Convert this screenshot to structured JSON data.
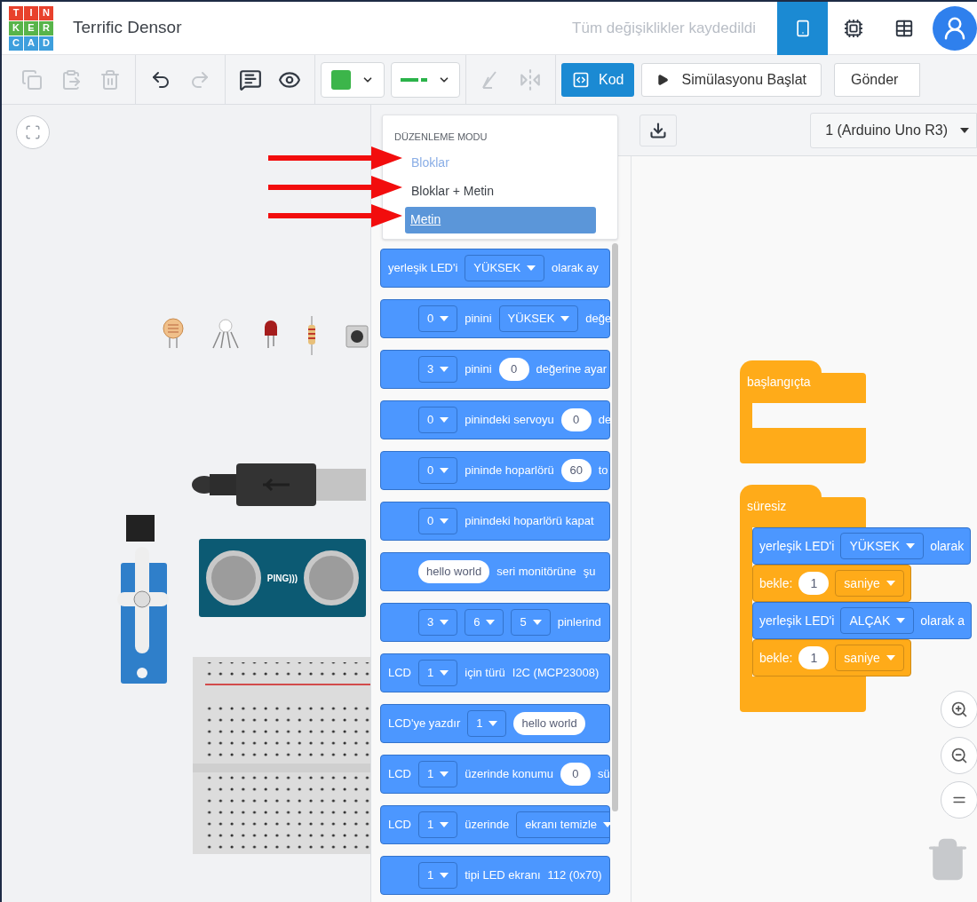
{
  "header": {
    "logo_letters": [
      "T",
      "I",
      "N",
      "K",
      "E",
      "R",
      "C",
      "A",
      "D"
    ],
    "title": "Terrific Densor",
    "save_status": "Tüm değişiklikler kaydedildi",
    "views": [
      {
        "selected": true
      },
      {
        "selected": false
      },
      {
        "selected": false
      }
    ]
  },
  "toolbar": {
    "edit_tools": [
      {
        "disabled": true
      },
      {
        "disabled": true
      },
      {
        "disabled": true
      }
    ],
    "history_tools": [
      {
        "disabled": false
      },
      {
        "disabled": true
      }
    ],
    "note_tools": [
      {
        "disabled": false
      },
      {
        "disabled": false
      }
    ],
    "transform_tools": [
      {
        "disabled": true
      },
      {
        "disabled": true
      }
    ],
    "code_button": {
      "label": "Kod",
      "selected": true
    },
    "simulate_button": "Simülasyonu Başlat",
    "send_button": "Gönder"
  },
  "circuit": {
    "sensor_label": "PING)))"
  },
  "editing_mode_menu": {
    "heading": "DÜZENLEME MODU",
    "options": [
      {
        "label": "Bloklar",
        "active": true,
        "selected": false
      },
      {
        "label": "Bloklar + Metin",
        "active": false,
        "selected": false
      },
      {
        "label": "Metin",
        "active": false,
        "selected": true
      }
    ]
  },
  "code_panel": {
    "device": "1 (Arduino Uno R3)",
    "palette": [
      {
        "indented": false,
        "segments": [
          {
            "kind": "text",
            "text": "yerleşik LED'i"
          },
          {
            "kind": "dropdown",
            "text": "YÜKSEK"
          },
          {
            "kind": "text",
            "text": "olarak ay"
          }
        ]
      },
      {
        "indented": true,
        "segments": [
          {
            "kind": "dropdown",
            "text": "0"
          },
          {
            "kind": "text",
            "text": "pinini"
          },
          {
            "kind": "dropdown",
            "text": "YÜKSEK"
          },
          {
            "kind": "text",
            "text": "değe"
          }
        ]
      },
      {
        "indented": true,
        "segments": [
          {
            "kind": "dropdown",
            "text": "3"
          },
          {
            "kind": "text",
            "text": "pinini"
          },
          {
            "kind": "input",
            "text": "0"
          },
          {
            "kind": "text",
            "text": "değerine ayar"
          }
        ]
      },
      {
        "indented": true,
        "segments": [
          {
            "kind": "dropdown",
            "text": "0"
          },
          {
            "kind": "text",
            "text": "pinindeki servoyu"
          },
          {
            "kind": "input",
            "text": "0"
          },
          {
            "kind": "text",
            "text": "de"
          }
        ]
      },
      {
        "indented": true,
        "segments": [
          {
            "kind": "dropdown",
            "text": "0"
          },
          {
            "kind": "text",
            "text": "pininde hoparlörü"
          },
          {
            "kind": "input",
            "text": "60"
          },
          {
            "kind": "text",
            "text": "to"
          }
        ]
      },
      {
        "indented": true,
        "segments": [
          {
            "kind": "dropdown",
            "text": "0"
          },
          {
            "kind": "text",
            "text": "pinindeki hoparlörü kapat"
          }
        ]
      },
      {
        "indented": true,
        "segments": [
          {
            "kind": "input",
            "text": "hello world"
          },
          {
            "kind": "text",
            "text": "seri monitörüne"
          },
          {
            "kind": "text",
            "text": "şu"
          }
        ]
      },
      {
        "indented": true,
        "segments": [
          {
            "kind": "dropdown",
            "text": "3"
          },
          {
            "kind": "dropdown",
            "text": "6"
          },
          {
            "kind": "dropdown",
            "text": "5"
          },
          {
            "kind": "text",
            "text": "pinlerind"
          }
        ]
      },
      {
        "indented": false,
        "segments": [
          {
            "kind": "text",
            "text": "LCD"
          },
          {
            "kind": "dropdown",
            "text": "1"
          },
          {
            "kind": "text",
            "text": "için türü"
          },
          {
            "kind": "text",
            "text": "I2C (MCP23008)"
          }
        ]
      },
      {
        "indented": false,
        "segments": [
          {
            "kind": "text",
            "text": "LCD'ye yazdır"
          },
          {
            "kind": "dropdown",
            "text": "1"
          },
          {
            "kind": "input",
            "text": "hello world"
          }
        ]
      },
      {
        "indented": false,
        "segments": [
          {
            "kind": "text",
            "text": "LCD"
          },
          {
            "kind": "dropdown",
            "text": "1"
          },
          {
            "kind": "text",
            "text": "üzerinde konumu"
          },
          {
            "kind": "input",
            "text": "0"
          },
          {
            "kind": "text",
            "text": "sü"
          }
        ]
      },
      {
        "indented": false,
        "segments": [
          {
            "kind": "text",
            "text": "LCD"
          },
          {
            "kind": "dropdown",
            "text": "1"
          },
          {
            "kind": "text",
            "text": "üzerinde"
          },
          {
            "kind": "dropdown",
            "text": "ekranı temizle"
          }
        ]
      },
      {
        "indented": true,
        "segments": [
          {
            "kind": "dropdown",
            "text": "1"
          },
          {
            "kind": "text",
            "text": "tipi LED ekranı"
          },
          {
            "kind": "text",
            "text": "112 (0x70)"
          }
        ]
      }
    ]
  },
  "workspace": {
    "scripts": [
      {
        "hat": "başlangıçta"
      },
      {
        "hat": "süresiz",
        "body": [
          {
            "kind": "output",
            "segments": [
              {
                "kind": "text",
                "text": "yerleşik LED'i"
              },
              {
                "kind": "dropdown",
                "text": "YÜKSEK"
              },
              {
                "kind": "text",
                "text": "olarak"
              }
            ]
          },
          {
            "kind": "control",
            "segments": [
              {
                "kind": "text",
                "text": "bekle:"
              },
              {
                "kind": "input",
                "text": "1"
              },
              {
                "kind": "dropdown",
                "text": "saniye"
              }
            ]
          },
          {
            "kind": "output",
            "segments": [
              {
                "kind": "text",
                "text": "yerleşik LED'i"
              },
              {
                "kind": "dropdown",
                "text": "ALÇAK"
              },
              {
                "kind": "text",
                "text": "olarak a"
              }
            ]
          },
          {
            "kind": "control",
            "segments": [
              {
                "kind": "text",
                "text": "bekle:"
              },
              {
                "kind": "input",
                "text": "1"
              },
              {
                "kind": "dropdown",
                "text": "saniye"
              }
            ]
          }
        ]
      }
    ]
  }
}
